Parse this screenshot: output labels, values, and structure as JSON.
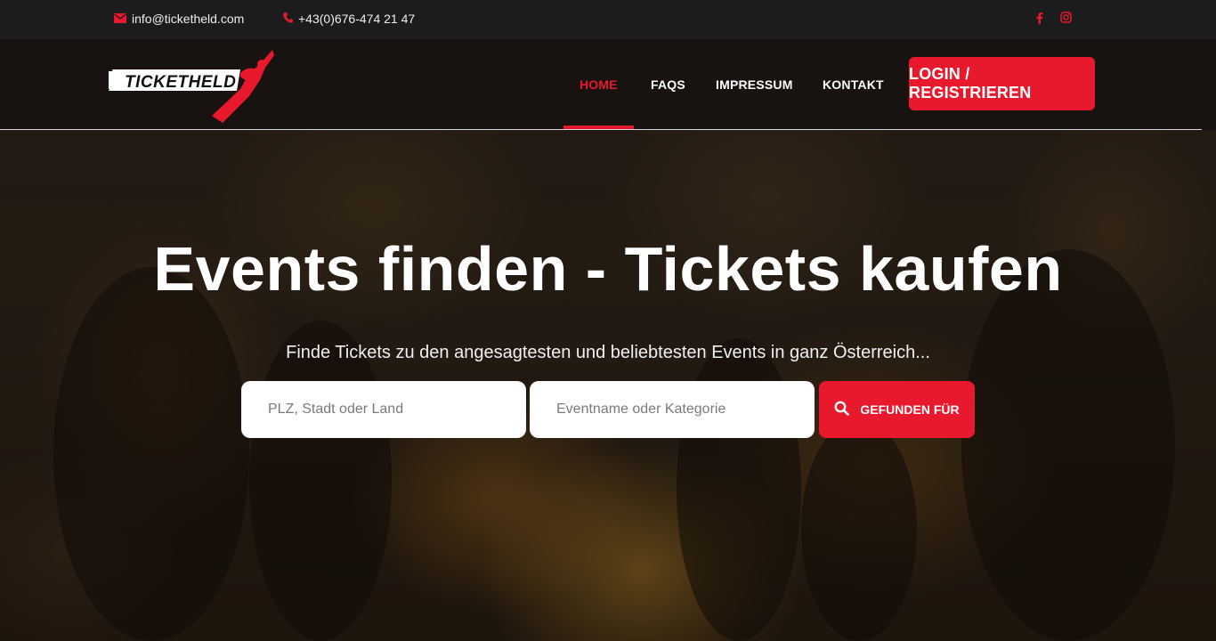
{
  "topbar": {
    "email": "info@ticketheld.com",
    "phone": "+43(0)676-474 21 47",
    "email_icon": "envelope-icon",
    "phone_icon": "phone-icon",
    "social": [
      {
        "icon": "facebook-icon"
      },
      {
        "icon": "instagram-icon"
      }
    ]
  },
  "brand": {
    "logo_text": "TICKETHELD",
    "accent_color": "#e8192c"
  },
  "nav": {
    "items": [
      {
        "label": "HOME",
        "active": true
      },
      {
        "label": "FAQS",
        "active": false
      },
      {
        "label": "IMPRESSUM",
        "active": false
      },
      {
        "label": "KONTAKT",
        "active": false
      }
    ],
    "login_label": "LOGIN / REGISTRIEREN"
  },
  "hero": {
    "title": "Events finden - Tickets kaufen",
    "subtitle": "Finde Tickets zu den angesagtesten und beliebtesten Events in ganz Österreich..."
  },
  "search": {
    "location_placeholder": "PLZ, Stadt oder Land",
    "event_placeholder": "Eventname oder Kategorie",
    "button_label": "GEFUNDEN FÜR",
    "button_icon": "search-icon"
  }
}
